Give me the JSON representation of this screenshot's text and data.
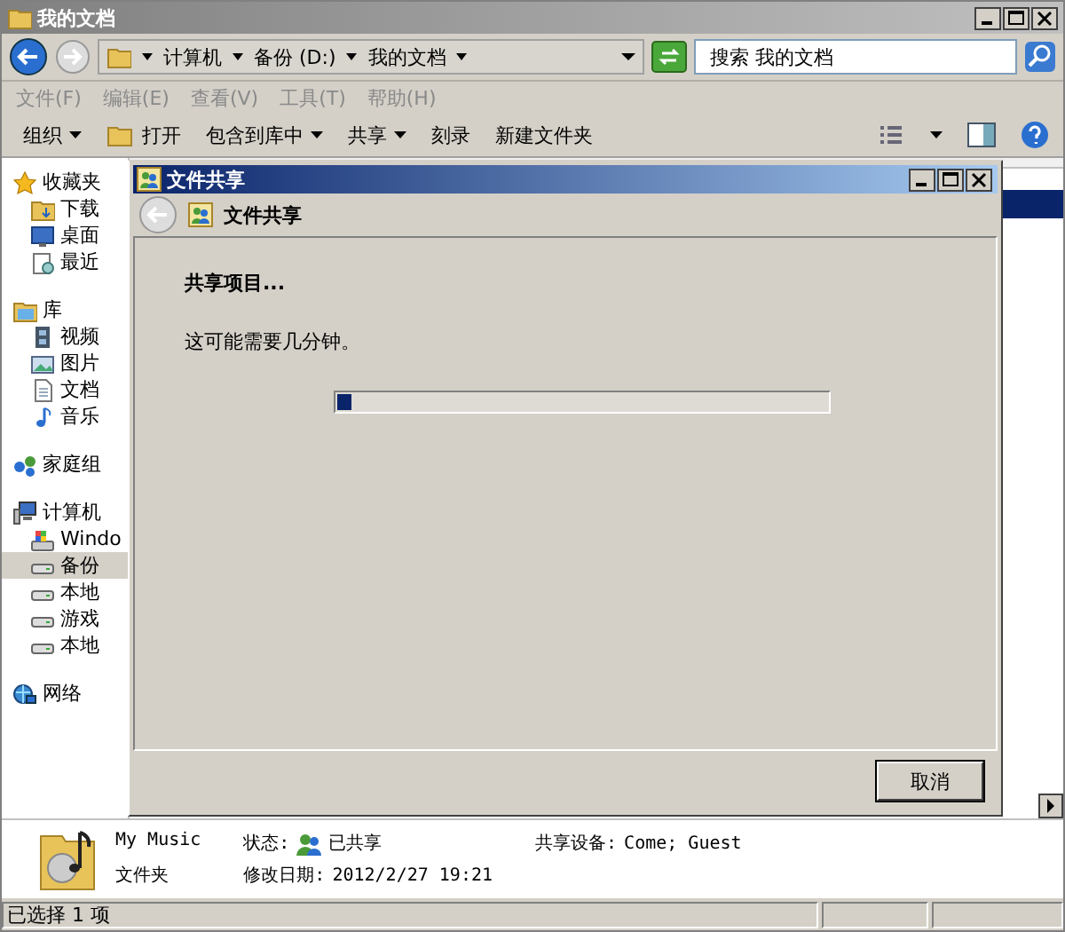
{
  "window": {
    "title": "我的文档"
  },
  "address_bar": {
    "path": [
      "计算机",
      "备份 (D:)",
      "我的文档"
    ]
  },
  "search": {
    "placeholder": "搜索 我的文档"
  },
  "menu": [
    {
      "label": "文件(F)",
      "disabled": true
    },
    {
      "label": "编辑(E)",
      "disabled": true
    },
    {
      "label": "查看(V)",
      "disabled": true
    },
    {
      "label": "工具(T)",
      "disabled": true
    },
    {
      "label": "帮助(H)",
      "disabled": true
    }
  ],
  "toolbar": [
    {
      "label": "组织",
      "kind": "menu"
    },
    {
      "label": "打开",
      "kind": "icon"
    },
    {
      "label": "包含到库中",
      "kind": "menu"
    },
    {
      "label": "共享",
      "kind": "menu"
    },
    {
      "label": "刻录",
      "kind": "plain"
    },
    {
      "label": "新建文件夹",
      "kind": "plain"
    }
  ],
  "sidebar": [
    {
      "label": "收藏夹",
      "kind": "star",
      "selected": false,
      "children": [
        {
          "label": "下载",
          "kind": "download",
          "selected": false
        },
        {
          "label": "桌面",
          "kind": "desktop",
          "selected": false
        },
        {
          "label": "最近",
          "kind": "recent",
          "selected": false
        }
      ]
    },
    {
      "label": "库",
      "kind": "library",
      "selected": false,
      "children": [
        {
          "label": "视频",
          "kind": "video",
          "selected": false
        },
        {
          "label": "图片",
          "kind": "picture",
          "selected": false
        },
        {
          "label": "文档",
          "kind": "document",
          "selected": false
        },
        {
          "label": "音乐",
          "kind": "music",
          "selected": false
        }
      ]
    },
    {
      "label": "家庭组",
      "kind": "homegroup",
      "selected": false
    },
    {
      "label": "计算机",
      "kind": "computer",
      "selected": false,
      "children": [
        {
          "label": "Windo",
          "kind": "windrive",
          "selected": false
        },
        {
          "label": "备份",
          "kind": "drive",
          "selected": true
        },
        {
          "label": "本地",
          "kind": "drive",
          "selected": false
        },
        {
          "label": "游戏",
          "kind": "drive",
          "selected": false
        },
        {
          "label": "本地",
          "kind": "drive",
          "selected": false
        }
      ]
    },
    {
      "label": "网络",
      "kind": "network",
      "selected": false
    }
  ],
  "dialog": {
    "title": "文件共享",
    "header": "文件共享",
    "heading": "共享项目...",
    "message": "这可能需要几分钟。",
    "progress": {
      "level": 0.03
    },
    "buttons": [
      "取消"
    ]
  },
  "details": {
    "name": "My Music",
    "type": "文件夹",
    "fields": [
      {
        "label": "状态:",
        "value": "已共享",
        "kind": "shared"
      },
      {
        "label": "修改日期:",
        "value": "2012/2/27 19:21",
        "kind": "text"
      },
      {
        "label": "共享设备:",
        "value": "Come; Guest",
        "kind": "text"
      }
    ]
  },
  "status_bar": {
    "text": "已选择 1 项"
  }
}
